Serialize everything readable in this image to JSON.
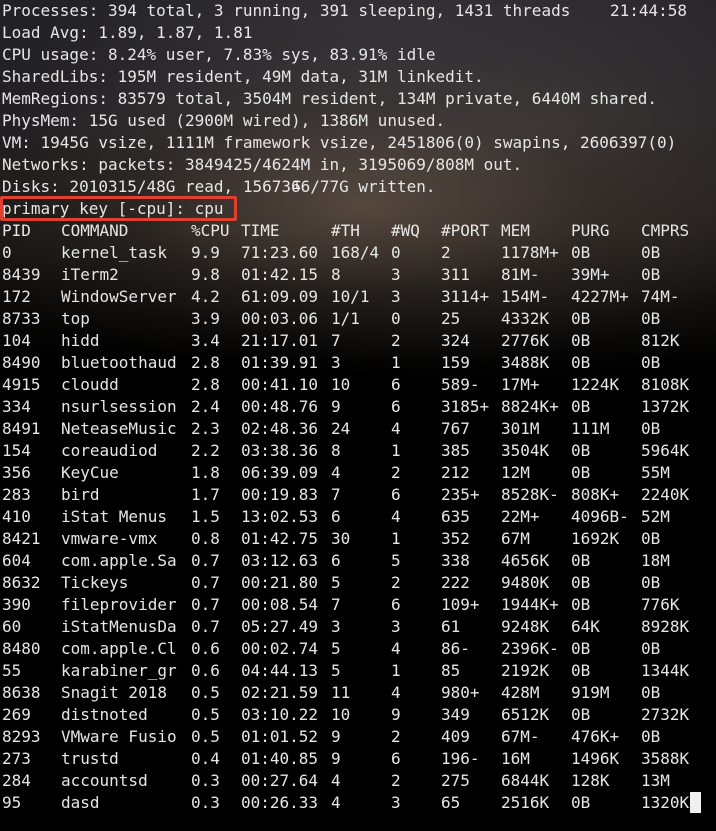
{
  "summary": {
    "processes": "Processes: 394 total, 3 running, 391 sleeping, 1431 threads",
    "clock": "21:44:58",
    "load_avg": "Load Avg: 1.89, 1.87, 1.81",
    "cpu_usage": "CPU usage: 8.24% user, 7.83% sys, 83.91% idle",
    "shared_libs": "SharedLibs: 195M resident, 49M data, 31M linkedit.",
    "mem_regions": "MemRegions: 83579 total, 3504M resident, 134M private, 6440M shared.",
    "phys_mem": "PhysMem: 15G used (2900M wired), 1386M unused.",
    "vm": "VM: 1945G vsize, 1111M framework vsize, 2451806(0) swapins, 2606397(0)",
    "networks": "Networks: packets: 3849425/4624M in, 3195069/808M out.",
    "disks": "Disks: 2010315/48G read, 1567366/77G written."
  },
  "prompt": {
    "text": "primary key [-cpu]: cpu"
  },
  "columns": [
    "PID",
    "COMMAND",
    "%CPU",
    "TIME",
    "#TH",
    "#WQ",
    "#PORT",
    "MEM",
    "PURG",
    "CMPRS"
  ],
  "processes": [
    [
      "0",
      "kernel_task",
      "9.9",
      "71:23.60",
      "168/4",
      "0",
      "2",
      "1178M+",
      "0B",
      "0B"
    ],
    [
      "8439",
      "iTerm2",
      "9.8",
      "01:42.15",
      "8",
      "3",
      "311",
      "81M-",
      "39M+",
      "0B"
    ],
    [
      "172",
      "WindowServer",
      "4.2",
      "61:09.09",
      "10/1",
      "3",
      "3114+",
      "154M-",
      "4227M+",
      "74M-"
    ],
    [
      "8733",
      "top",
      "3.9",
      "00:03.06",
      "1/1",
      "0",
      "25",
      "4332K",
      "0B",
      "0B"
    ],
    [
      "104",
      "hidd",
      "3.4",
      "21:17.01",
      "7",
      "2",
      "324",
      "2776K",
      "0B",
      "812K"
    ],
    [
      "8490",
      "bluetoothaud",
      "2.8",
      "01:39.91",
      "3",
      "1",
      "159",
      "3488K",
      "0B",
      "0B"
    ],
    [
      "4915",
      "cloudd",
      "2.8",
      "00:41.10",
      "10",
      "6",
      "589-",
      "17M+",
      "1224K",
      "8108K"
    ],
    [
      "334",
      "nsurlsession",
      "2.4",
      "00:48.76",
      "9",
      "6",
      "3185+",
      "8824K+",
      "0B",
      "1372K"
    ],
    [
      "8491",
      "NeteaseMusic",
      "2.3",
      "02:48.36",
      "24",
      "4",
      "767",
      "301M",
      "111M",
      "0B"
    ],
    [
      "154",
      "coreaudiod",
      "2.2",
      "03:38.36",
      "8",
      "1",
      "385",
      "3504K",
      "0B",
      "5964K"
    ],
    [
      "356",
      "KeyCue",
      "1.8",
      "06:39.09",
      "4",
      "2",
      "212",
      "12M",
      "0B",
      "55M"
    ],
    [
      "283",
      "bird",
      "1.7",
      "00:19.83",
      "7",
      "6",
      "235+",
      "8528K-",
      "808K+",
      "2240K"
    ],
    [
      "410",
      "iStat Menus",
      "1.5",
      "13:02.53",
      "6",
      "4",
      "635",
      "22M+",
      "4096B-",
      "52M"
    ],
    [
      "8421",
      "vmware-vmx",
      "0.8",
      "01:42.75",
      "30",
      "1",
      "352",
      "67M",
      "1692K",
      "0B"
    ],
    [
      "604",
      "com.apple.Sa",
      "0.7",
      "03:12.63",
      "6",
      "5",
      "338",
      "4656K",
      "0B",
      "18M"
    ],
    [
      "8632",
      "Tickeys",
      "0.7",
      "00:21.80",
      "5",
      "2",
      "222",
      "9480K",
      "0B",
      "0B"
    ],
    [
      "390",
      "fileprovider",
      "0.7",
      "00:08.54",
      "7",
      "6",
      "109+",
      "1944K+",
      "0B",
      "776K"
    ],
    [
      "60",
      "iStatMenusDa",
      "0.7",
      "05:27.49",
      "3",
      "3",
      "61",
      "9248K",
      "64K",
      "8928K"
    ],
    [
      "8480",
      "com.apple.Cl",
      "0.6",
      "00:02.74",
      "5",
      "4",
      "86-",
      "2396K-",
      "0B",
      "0B"
    ],
    [
      "55",
      "karabiner_gr",
      "0.6",
      "04:44.13",
      "5",
      "1",
      "85",
      "2192K",
      "0B",
      "1344K"
    ],
    [
      "8638",
      "Snagit 2018",
      "0.5",
      "02:21.59",
      "11",
      "4",
      "980+",
      "428M",
      "919M",
      "0B"
    ],
    [
      "269",
      "distnoted",
      "0.5",
      "03:10.22",
      "10",
      "9",
      "349",
      "6512K",
      "0B",
      "2732K"
    ],
    [
      "8293",
      "VMware Fusio",
      "0.5",
      "01:01.52",
      "9",
      "2",
      "409",
      "67M-",
      "476K+",
      "0B"
    ],
    [
      "273",
      "trustd",
      "0.4",
      "01:40.85",
      "9",
      "6",
      "196-",
      "16M",
      "1496K",
      "3588K"
    ],
    [
      "284",
      "accountsd",
      "0.3",
      "00:27.64",
      "4",
      "2",
      "275",
      "6844K",
      "128K",
      "13M"
    ],
    [
      "95",
      "dasd",
      "0.3",
      "00:26.33",
      "4",
      "3",
      "65",
      "2516K",
      "0B",
      "1320K"
    ]
  ]
}
